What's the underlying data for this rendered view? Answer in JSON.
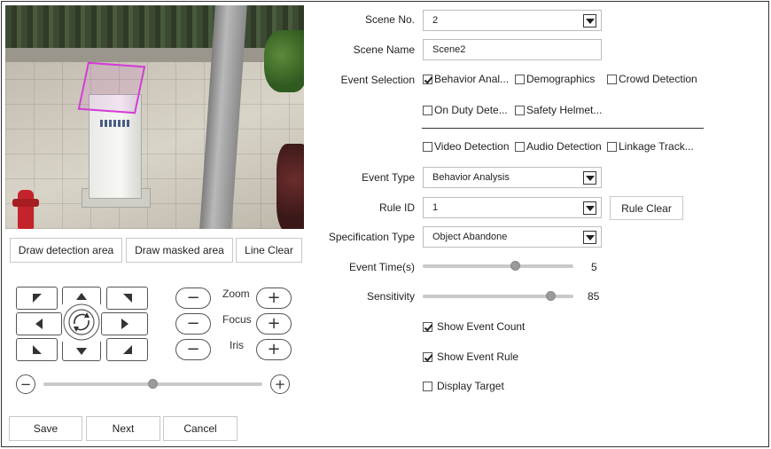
{
  "preview": {
    "overlay_color": "#d23cd6"
  },
  "preview_buttons": {
    "draw_detection": "Draw detection area",
    "draw_masked": "Draw masked area",
    "line_clear": "Line Clear"
  },
  "ptz": {
    "zoom_label": "Zoom",
    "focus_label": "Focus",
    "iris_label": "Iris",
    "minus": "−",
    "plus": "+",
    "speed_slider_value": 0.5
  },
  "footer": {
    "save": "Save",
    "next": "Next",
    "cancel": "Cancel"
  },
  "form": {
    "scene_no": {
      "label": "Scene No.",
      "value": "2"
    },
    "scene_name": {
      "label": "Scene Name",
      "value": "Scene2"
    },
    "event_selection": {
      "label": "Event Selection",
      "options": [
        {
          "label": "Behavior Anal...",
          "checked": true
        },
        {
          "label": "Demographics",
          "checked": false
        },
        {
          "label": "Crowd Detection",
          "checked": false
        },
        {
          "label": "On Duty Dete...",
          "checked": false
        },
        {
          "label": "Safety Helmet...",
          "checked": false
        },
        {
          "label": "Video Detection",
          "checked": false
        },
        {
          "label": "Audio Detection",
          "checked": false
        },
        {
          "label": "Linkage Track...",
          "checked": false
        }
      ]
    },
    "event_type": {
      "label": "Event Type",
      "value": "Behavior Analysis"
    },
    "rule_id": {
      "label": "Rule ID",
      "value": "1",
      "button": "Rule Clear"
    },
    "specification_type": {
      "label": "Specification Type",
      "value": "Object Abandone"
    },
    "event_time": {
      "label": "Event Time(s)",
      "value": "5",
      "fraction": 0.62
    },
    "sensitivity": {
      "label": "Sensitivity",
      "value": "85",
      "fraction": 0.85
    },
    "show_event_count": {
      "label": "Show Event Count",
      "checked": true
    },
    "show_event_rule": {
      "label": "Show Event Rule",
      "checked": true
    },
    "display_target": {
      "label": "Display Target",
      "checked": false
    }
  }
}
